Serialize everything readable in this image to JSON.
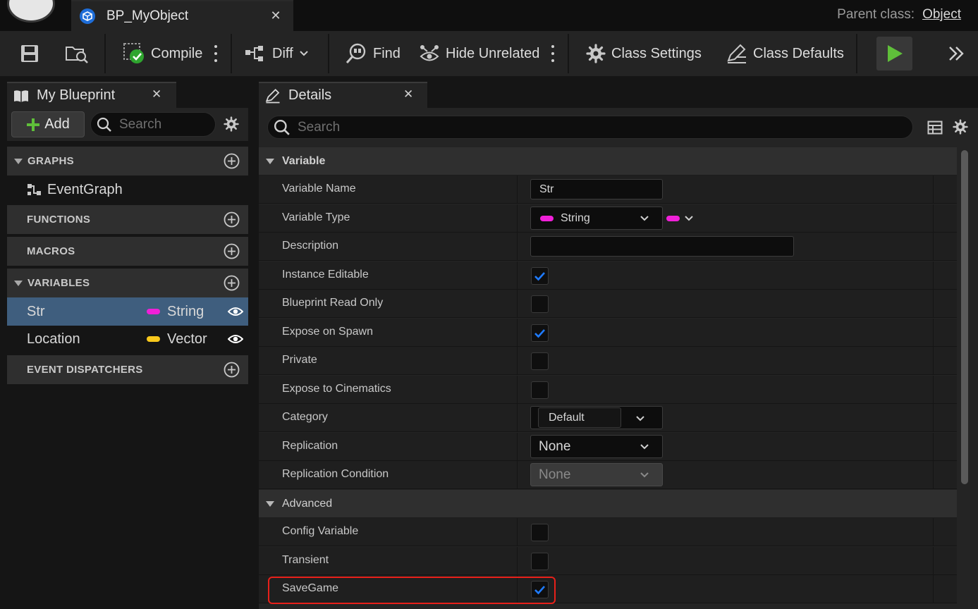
{
  "window": {
    "tab_title": "BP_MyObject",
    "parent_class_label": "Parent class:",
    "parent_class_value": "Object"
  },
  "toolbar": {
    "compile": "Compile",
    "diff": "Diff",
    "find": "Find",
    "hide_unrelated": "Hide Unrelated",
    "class_settings": "Class Settings",
    "class_defaults": "Class Defaults"
  },
  "my_blueprint": {
    "tab_label": "My Blueprint",
    "add_label": "Add",
    "search_placeholder": "Search",
    "sections": {
      "graphs": "GRAPHS",
      "functions": "FUNCTIONS",
      "macros": "MACROS",
      "variables": "VARIABLES",
      "event_dispatchers": "EVENT DISPATCHERS"
    },
    "graphs": [
      {
        "label": "EventGraph"
      }
    ],
    "variables": [
      {
        "name": "Str",
        "type": "String",
        "color": "#f020d8"
      },
      {
        "name": "Location",
        "type": "Vector",
        "color": "#f8c81c"
      }
    ]
  },
  "details": {
    "tab_label": "Details",
    "search_placeholder": "Search",
    "categories": {
      "variable": "Variable",
      "advanced": "Advanced"
    },
    "properties": {
      "variable_name": {
        "label": "Variable Name",
        "value": "Str"
      },
      "variable_type": {
        "label": "Variable Type",
        "value": "String",
        "color": "#f020d8"
      },
      "description": {
        "label": "Description",
        "value": ""
      },
      "instance_editable": {
        "label": "Instance Editable",
        "checked": true
      },
      "blueprint_read_only": {
        "label": "Blueprint Read Only",
        "checked": false
      },
      "expose_on_spawn": {
        "label": "Expose on Spawn",
        "checked": true
      },
      "private": {
        "label": "Private",
        "checked": false
      },
      "expose_to_cinematics": {
        "label": "Expose to Cinematics",
        "checked": false
      },
      "category": {
        "label": "Category",
        "value": "Default"
      },
      "replication": {
        "label": "Replication",
        "value": "None"
      },
      "replication_condition": {
        "label": "Replication Condition",
        "value": "None"
      },
      "config_variable": {
        "label": "Config Variable",
        "checked": false
      },
      "transient": {
        "label": "Transient",
        "checked": false
      },
      "savegame": {
        "label": "SaveGame",
        "checked": true
      }
    }
  },
  "colors": {
    "accent_check": "#1f7bff",
    "play_green": "#5fbf3a",
    "highlight": "#e8201a"
  }
}
